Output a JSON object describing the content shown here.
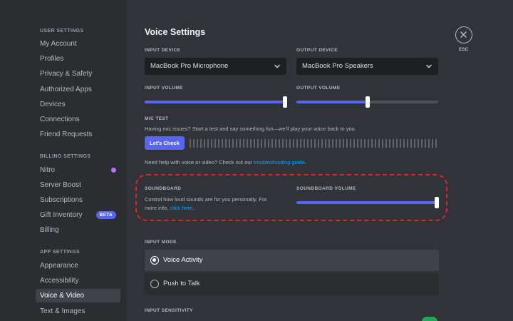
{
  "sidebar": {
    "user_settings": {
      "header": "USER SETTINGS",
      "items": [
        "My Account",
        "Profiles",
        "Privacy & Safety",
        "Authorized Apps",
        "Devices",
        "Connections",
        "Friend Requests"
      ]
    },
    "billing_settings": {
      "header": "BILLING SETTINGS",
      "items": [
        "Nitro",
        "Server Boost",
        "Subscriptions",
        "Gift Inventory",
        "Billing"
      ],
      "gift_badge": "BETA"
    },
    "app_settings": {
      "header": "APP SETTINGS",
      "items": [
        "Appearance",
        "Accessibility",
        "Voice & Video",
        "Text & Images"
      ],
      "active": "Voice & Video"
    }
  },
  "page": {
    "title": "Voice Settings",
    "close_label": "ESC"
  },
  "input_device": {
    "label": "INPUT DEVICE",
    "value": "MacBook Pro Microphone"
  },
  "output_device": {
    "label": "OUTPUT DEVICE",
    "value": "MacBook Pro Speakers"
  },
  "input_volume": {
    "label": "INPUT VOLUME",
    "level": 0.99
  },
  "output_volume": {
    "label": "OUTPUT VOLUME",
    "level": 0.5
  },
  "mic_test": {
    "label": "MIC TEST",
    "description": "Having mic issues? Start a test and say something fun—we'll play your voice back to you.",
    "button": "Let's Check",
    "help_prefix": "Need help with voice or video? Check out our ",
    "help_link": "troubleshooting guide",
    "help_suffix": "."
  },
  "soundboard": {
    "label": "SOUNDBOARD",
    "description_line1": "Control how loud sounds are for you personally. For",
    "description_line2": "more info, ",
    "link": "click here",
    "link_suffix": ".",
    "volume_label": "SOUNDBOARD VOLUME",
    "level": 0.99
  },
  "input_mode": {
    "label": "INPUT MODE",
    "options": [
      "Voice Activity",
      "Push to Talk"
    ],
    "selected": "Voice Activity"
  },
  "input_sensitivity": {
    "label": "INPUT SENSITIVITY"
  },
  "colors": {
    "accent": "#5865f2",
    "link": "#00a8fc",
    "highlight": "#d6262b",
    "toggle_on": "#23a55a"
  }
}
